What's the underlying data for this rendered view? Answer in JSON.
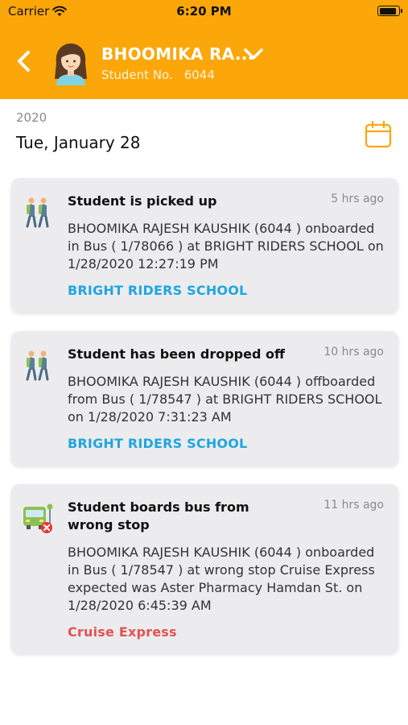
{
  "status_bar": {
    "carrier": "Carrier",
    "time": "6:20 PM",
    "icons": [
      "wifi-icon",
      "battery-icon"
    ]
  },
  "header": {
    "student_name": "BHOOMIKA RA...",
    "student_no_label": "Student No.",
    "student_no": "6044",
    "back_icon": "back-arrow-icon",
    "dropdown_icon": "chevron-down-icon",
    "background_color": "#FBA709"
  },
  "date_header": {
    "year": "2020",
    "date": "Tue, January 28",
    "calendar_icon": "calendar-icon"
  },
  "notifications": [
    {
      "icon": "students-walking-icon",
      "title": "Student is picked up",
      "time_ago": "5 hrs ago",
      "body": "BHOOMIKA RAJESH KAUSHIK  (6044 ) onboarded in Bus ( 1/78066 )  at BRIGHT RIDERS SCHOOL on 1/28/2020 12:27:19 PM",
      "location": "BRIGHT RIDERS SCHOOL",
      "location_color": "#1FA6E0"
    },
    {
      "icon": "students-walking-icon",
      "title": "Student has been dropped off",
      "time_ago": "10 hrs ago",
      "body": "BHOOMIKA RAJESH KAUSHIK  (6044 ) offboarded from Bus ( 1/78547 )  at BRIGHT RIDERS SCHOOL on 1/28/2020 7:31:23 AM",
      "location": "BRIGHT RIDERS SCHOOL",
      "location_color": "#1FA6E0"
    },
    {
      "icon": "bus-wrong-stop-icon",
      "title": "Student boards bus from wrong stop",
      "time_ago": "11 hrs ago",
      "body": "BHOOMIKA RAJESH KAUSHIK  (6044 ) onboarded in Bus ( 1/78547 ) at wrong stop Cruise Express expected was Aster Pharmacy Hamdan St. on 1/28/2020 6:45:39 AM",
      "location": "Cruise Express",
      "location_color": "#E25353"
    }
  ]
}
